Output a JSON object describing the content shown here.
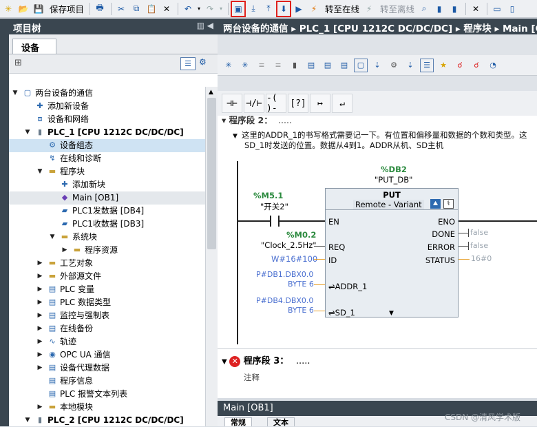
{
  "toolbar": {
    "save_label": "保存项目",
    "go_online": "转至在线",
    "go_offline": "转至离线"
  },
  "project_tree": {
    "title": "项目树",
    "devices_tab": "设备",
    "items": [
      {
        "label": "两台设备的通信",
        "arrow": "▼",
        "icon": "project-icon"
      },
      {
        "label": "添加新设备",
        "arrow": "",
        "icon": "add-device-icon"
      },
      {
        "label": "设备和网络",
        "arrow": "",
        "icon": "network-icon"
      },
      {
        "label": "PLC_1 [CPU 1212C DC/DC/DC]",
        "arrow": "▼",
        "icon": "plc-icon"
      },
      {
        "label": "设备组态",
        "arrow": "",
        "icon": "device-config-icon"
      },
      {
        "label": "在线和诊断",
        "arrow": "",
        "icon": "diagnostics-icon"
      },
      {
        "label": "程序块",
        "arrow": "▼",
        "icon": "folder-icon"
      },
      {
        "label": "添加新块",
        "arrow": "",
        "icon": "add-block-icon"
      },
      {
        "label": "Main [OB1]",
        "arrow": "",
        "icon": "ob-icon"
      },
      {
        "label": "PLC1发数据 [DB4]",
        "arrow": "",
        "icon": "db-icon"
      },
      {
        "label": "PLC1收数据 [DB3]",
        "arrow": "",
        "icon": "db-icon"
      },
      {
        "label": "系统块",
        "arrow": "▼",
        "icon": "folder-icon"
      },
      {
        "label": "程序资源",
        "arrow": "▶",
        "icon": "folder-icon"
      },
      {
        "label": "工艺对象",
        "arrow": "▶",
        "icon": "folder-icon"
      },
      {
        "label": "外部源文件",
        "arrow": "▶",
        "icon": "folder-icon"
      },
      {
        "label": "PLC 变量",
        "arrow": "▶",
        "icon": "tag-table-icon"
      },
      {
        "label": "PLC 数据类型",
        "arrow": "▶",
        "icon": "data-type-icon"
      },
      {
        "label": "监控与强制表",
        "arrow": "▶",
        "icon": "watch-table-icon"
      },
      {
        "label": "在线备份",
        "arrow": "▶",
        "icon": "backup-icon"
      },
      {
        "label": "轨迹",
        "arrow": "▶",
        "icon": "trace-icon"
      },
      {
        "label": "OPC UA 通信",
        "arrow": "▶",
        "icon": "opcua-icon"
      },
      {
        "label": "设备代理数据",
        "arrow": "▶",
        "icon": "proxy-icon"
      },
      {
        "label": "程序信息",
        "arrow": "",
        "icon": "program-info-icon"
      },
      {
        "label": "PLC 报警文本列表",
        "arrow": "",
        "icon": "alarm-text-icon"
      },
      {
        "label": "本地模块",
        "arrow": "▶",
        "icon": "folder-icon"
      },
      {
        "label": "PLC_2 [CPU 1212C DC/DC/DC]",
        "arrow": "▼",
        "icon": "plc-icon"
      }
    ]
  },
  "breadcrumb": {
    "project": "两台设备的通信",
    "plc": "PLC_1 [CPU 1212C DC/DC/DC]",
    "folder": "程序块",
    "block": "Main [O"
  },
  "editor": {
    "network2_title": "程序段 2：",
    "network2_comment": "这里的ADDR_1的书写格式需要记一下。有位置和偏移量和数据的个数和类型。这",
    "network2_comment2": "SD_1时发送的位置。数据从4到1。ADDR从机、SD主机",
    "db_address": "%DB2",
    "db_name": "\"PUT_DB\"",
    "block_name": "PUT",
    "remote": "Remote",
    "variant": "Variant",
    "contact_address": "%M5.1",
    "contact_name": "\"开关2\"",
    "req_address": "%M0.2",
    "req_name": "\"Clock_2.5Hz\"",
    "id_value": "W#16#100",
    "addr1_value": "P#DB1.DBX0.0",
    "addr1_type": "BYTE 6",
    "sd1_value": "P#DB4.DBX0.0",
    "sd1_type": "BYTE 6",
    "pins_in": [
      "EN",
      "REQ",
      "ID",
      "ADDR_1",
      "SD_1"
    ],
    "pins_out": [
      "ENO",
      "DONE",
      "ERROR",
      "STATUS"
    ],
    "done_value": "false",
    "error_value": "false",
    "status_value": "16#0",
    "network3_title": "程序段 3：",
    "network3_dots": ".....",
    "network2_dots": ".....",
    "network3_comment": "注释"
  },
  "bottom": {
    "title": "Main [OB1]",
    "tab1": "常规",
    "tab2": "文本"
  },
  "watermark": "CSDN @清风学术版",
  "colors": {
    "header": "#3a4650",
    "selection": "#cfe3f3",
    "address": "#2b8a3e",
    "value": "#4a6fd0",
    "error_red": "#d22"
  }
}
